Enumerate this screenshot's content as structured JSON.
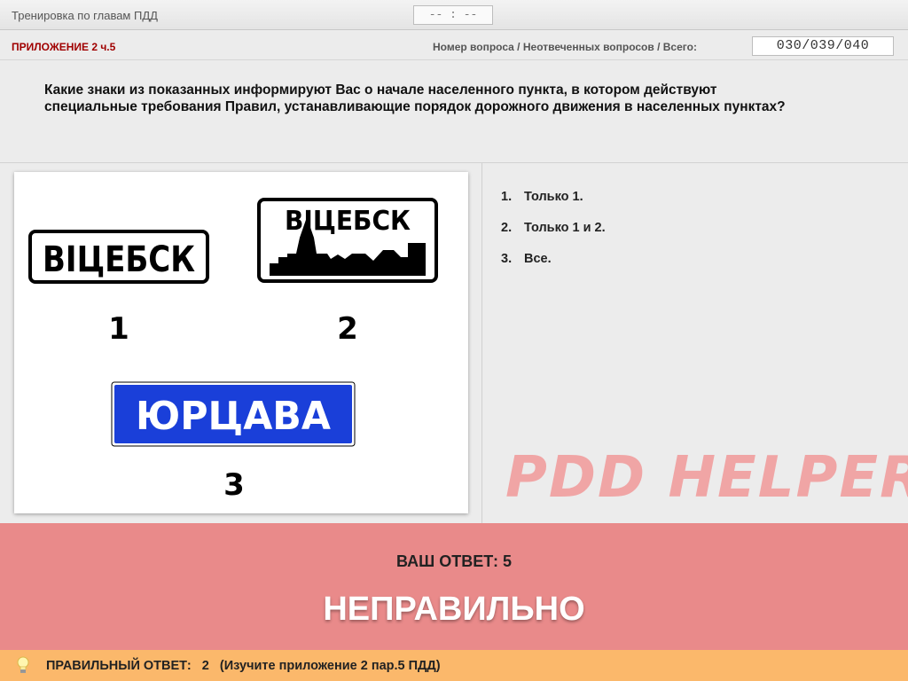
{
  "header": {
    "title": "Тренировка по главам ПДД",
    "timer": "-- : --"
  },
  "info": {
    "section": "ПРИЛОЖЕНИЕ 2 ч.5",
    "counter_label": "Номер вопроса / Неотвеченных вопросов / Всего:",
    "counter_value": "030/039/040"
  },
  "question": {
    "text": "Какие знаки из показанных информируют Вас о начале населенного пункта, в котором действуют специальные требования Правил, устанавливающие порядок дорожного движения в населенных пунктах?"
  },
  "image": {
    "sign1_text": "ВІЦЕБСК",
    "sign1_label": "1",
    "sign2_text": "ВІЦЕБСК",
    "sign2_label": "2",
    "sign3_text": "ЮРЦАВА",
    "sign3_label": "3",
    "sign3_color": "#1a3fd9"
  },
  "answers": [
    {
      "num": "1.",
      "text": "Только 1."
    },
    {
      "num": "2.",
      "text": "Только 1 и 2."
    },
    {
      "num": "3.",
      "text": "Все."
    }
  ],
  "watermark": "PDD HELPER",
  "result": {
    "your_answer": "ВАШ  ОТВЕТ:   5",
    "verdict": "НЕПРАВИЛЬНО",
    "color": "#e98a8a"
  },
  "footer": {
    "correct": "ПРАВИЛЬНЫЙ ОТВЕТ:   2   (Изучите приложение 2 пар.5 ПДД)",
    "color": "#fbb86b"
  }
}
